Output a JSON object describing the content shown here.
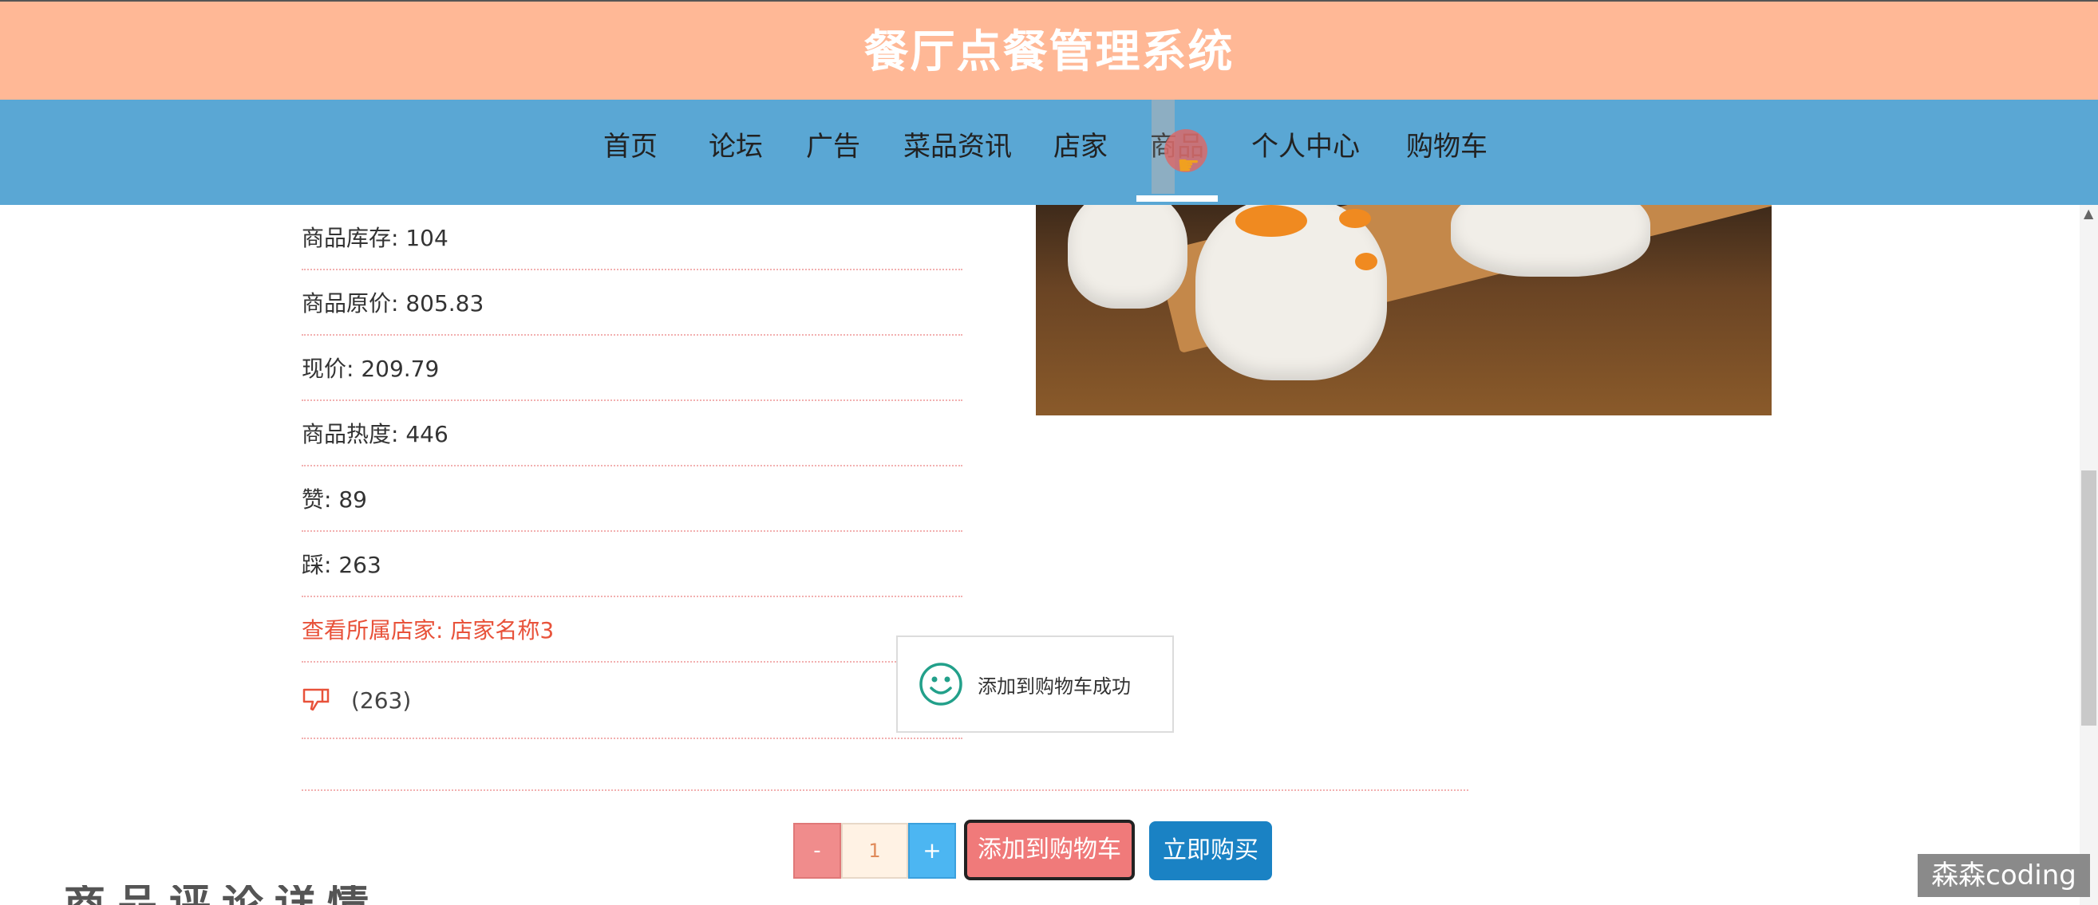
{
  "header": {
    "title": "餐厅点餐管理系统"
  },
  "nav": {
    "items": [
      {
        "label": "首页"
      },
      {
        "label": "论坛"
      },
      {
        "label": "广告"
      },
      {
        "label": "菜品资讯"
      },
      {
        "label": "店家"
      },
      {
        "label": "商品"
      },
      {
        "label": "个人中心"
      },
      {
        "label": "购物车"
      }
    ],
    "active": "商品"
  },
  "product": {
    "stock": "商品库存: 104",
    "original_price": "商品原价: 805.83",
    "current_price": "现价: 209.79",
    "heat": "商品热度: 446",
    "likes": "赞: 89",
    "dislikes": "踩: 263",
    "shop_link": "查看所属店家: 店家名称3",
    "dislike_count": "(263)"
  },
  "toast": {
    "message": "添加到购物车成功"
  },
  "purchase": {
    "minus_label": "-",
    "quantity": "1",
    "plus_label": "+",
    "add_to_cart_label": "添加到购物车",
    "buy_now_label": "立即购买"
  },
  "watermark": {
    "text": "森森coding"
  },
  "cut_text": {
    "text": "商品评论详情"
  },
  "colors": {
    "header_bg": "#ffb896",
    "nav_bg": "#5aa7d4",
    "link": "#e8523a",
    "cart_button": "#f07a7a",
    "buy_button": "#1a82c4",
    "plus_button": "#4cb6f2",
    "minus_button": "#f08c8c"
  }
}
